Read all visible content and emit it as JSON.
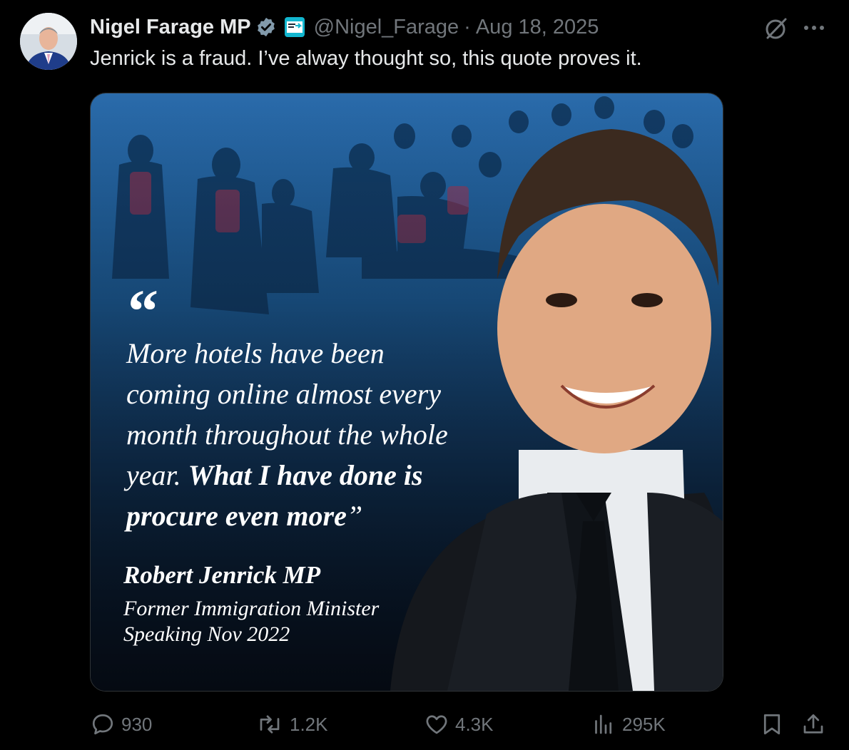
{
  "author": {
    "display_name": "Nigel Farage MP",
    "handle": "@Nigel_Farage",
    "separator": "·",
    "date": "Aug 18, 2025",
    "verified_color": "#829aab",
    "affiliate_badge_color": "#12b6cf"
  },
  "tweet": {
    "text": "Jenrick is a fraud. I’ve alway thought so, this quote proves it."
  },
  "media": {
    "quote_mark": "“",
    "quote_lines": [
      "More hotels have been",
      "coming online almost every",
      "month throughout the whole",
      "year. "
    ],
    "quote_bold_1": "What I have done is",
    "quote_bold_2": "procure even more",
    "quote_close": "”",
    "speaker_name": "Robert Jenrick MP",
    "speaker_role": "Former Immigration Minister",
    "speaker_date": "Speaking Nov 2022"
  },
  "actions": {
    "replies": "930",
    "reposts": "1.2K",
    "likes": "4.3K",
    "views": "295K"
  },
  "icons": {
    "grok": "grok-icon",
    "more": "more-icon",
    "reply": "reply-icon",
    "repost": "repost-icon",
    "like": "heart-icon",
    "views": "views-icon",
    "bookmark": "bookmark-icon",
    "share": "share-icon"
  }
}
